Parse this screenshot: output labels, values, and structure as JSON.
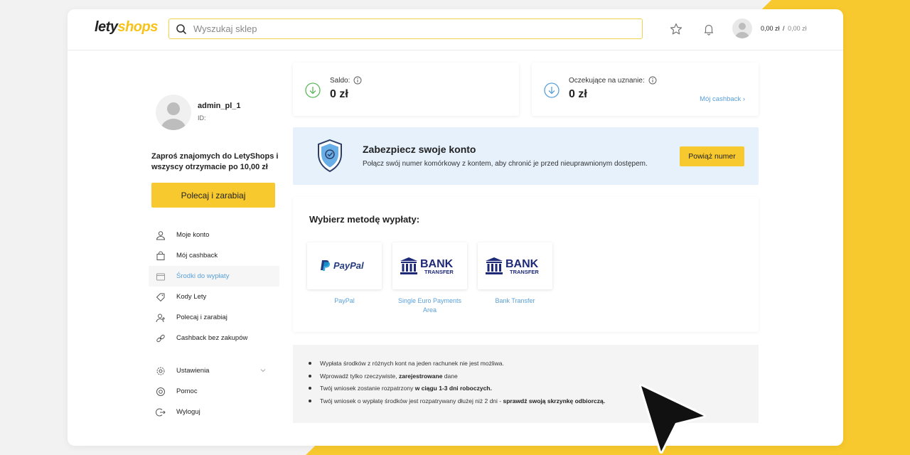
{
  "header": {
    "logo_part1": "lety",
    "logo_part2": "shops",
    "search_placeholder": "Wyszukaj sklep",
    "balance_main": "0,00 zł",
    "balance_separator": "/",
    "balance_pending": "0,00 zł"
  },
  "profile": {
    "username": "admin_pl_1",
    "id_label": "ID:"
  },
  "invite": {
    "text": "Zaproś znajomych do LetyShops i wszyscy otrzymacie po 10,00 zł",
    "button_label": "Polecaj i zarabiaj"
  },
  "sidebar": {
    "items": [
      {
        "label": "Moje konto",
        "icon": "user-icon"
      },
      {
        "label": "Mój cashback",
        "icon": "shopping-bag-icon"
      },
      {
        "label": "Środki do wypłaty",
        "icon": "wallet-icon",
        "active": true
      },
      {
        "label": "Kody Lety",
        "icon": "tag-icon"
      },
      {
        "label": "Polecaj i zarabiaj",
        "icon": "user-plus-icon"
      },
      {
        "label": "Cashback bez zakupów",
        "icon": "link-icon"
      }
    ],
    "bottom_items": [
      {
        "label": "Ustawienia",
        "icon": "gear-icon"
      },
      {
        "label": "Pomoc",
        "icon": "lifebuoy-icon"
      },
      {
        "label": "Wyloguj",
        "icon": "logout-icon"
      }
    ]
  },
  "stats": {
    "saldo_label": "Saldo:",
    "saldo_value": "0 zł",
    "pending_label": "Oczekujące na uznanie:",
    "pending_value": "0 zł",
    "cashback_link": "Mój cashback ›"
  },
  "secure_banner": {
    "title": "Zabezpiecz swoje konto",
    "description": "Połącz swój numer komórkowy z kontem, aby chronić je przed nieuprawnionym dostępem.",
    "button_label": "Powiąż numer"
  },
  "payout": {
    "title": "Wybierz metodę wypłaty:",
    "methods": [
      {
        "name": "PayPal",
        "logo_text": "PayPal"
      },
      {
        "name": "Single Euro Payments Area",
        "logo_text": "BANK",
        "logo_sub": "TRANSFER"
      },
      {
        "name": "Bank Transfer",
        "logo_text": "BANK",
        "logo_sub": "TRANSFER"
      }
    ]
  },
  "notes": [
    {
      "pre": "Wypłata środków z różnych kont na jeden rachunek nie jest możliwa.",
      "bold": "",
      "post": ""
    },
    {
      "pre": "Wprowadź tylko rzeczywiste, ",
      "bold": "zarejestrowane",
      "post": " dane"
    },
    {
      "pre": "Twój wniosek zostanie rozpatrzony ",
      "bold": "w ciągu 1-3 dni roboczych.",
      "post": ""
    },
    {
      "pre": "Twój wniosek o wypłatę środków jest rozpatrywany dłużej niż 2 dni - ",
      "bold": "sprawdź swoją skrzynkę odbiorczą.",
      "post": ""
    }
  ],
  "colors": {
    "brand_yellow": "#f7c31a",
    "link_blue": "#5aa0d8",
    "banner_blue": "#e6f1fc",
    "bank_navy": "#1e2a78",
    "paypal_dark": "#253b80",
    "paypal_light": "#179bd7"
  }
}
